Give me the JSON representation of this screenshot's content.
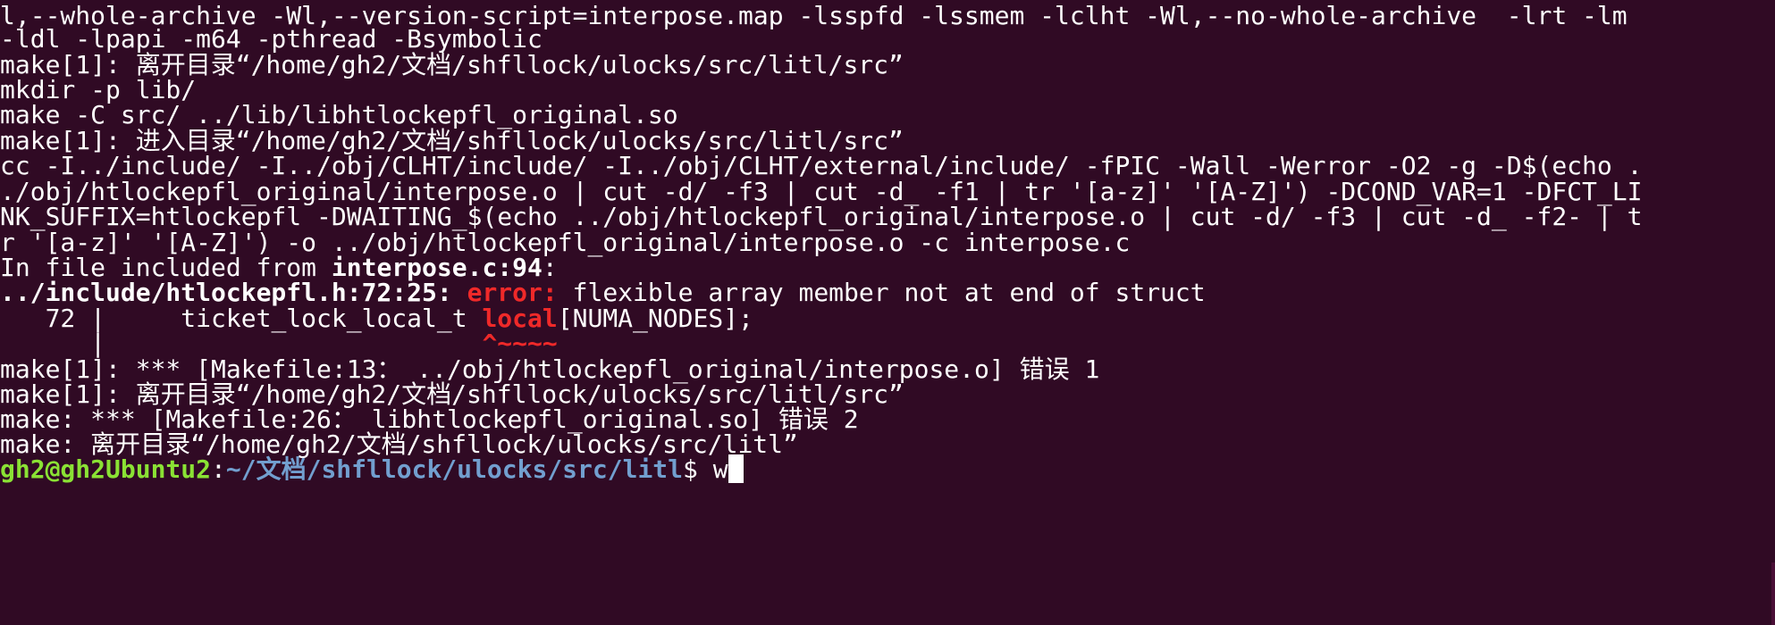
{
  "terminal": {
    "lines": [
      "l,--whole-archive -Wl,--version-script=interpose.map -lsspfd -lssmem -lclht -Wl,--no-whole-archive  -lrt -lm",
      "-ldl -lpapi -m64 -pthread -Bsymbolic",
      "make[1]: 离开目录“/home/gh2/文档/shfllock/ulocks/src/litl/src”",
      "mkdir -p lib/",
      "make -C src/ ../lib/libhtlockepfl_original.so",
      "make[1]: 进入目录“/home/gh2/文档/shfllock/ulocks/src/litl/src”",
      "cc -I../include/ -I../obj/CLHT/include/ -I../obj/CLHT/external/include/ -fPIC -Wall -Werror -O2 -g -D$(echo .",
      "./obj/htlockepfl_original/interpose.o | cut -d/ -f3 | cut -d_ -f1 | tr '[a-z]' '[A-Z]') -DCOND_VAR=1 -DFCT_LI",
      "NK_SUFFIX=htlockepfl -DWAITING_$(echo ../obj/htlockepfl_original/interpose.o | cut -d/ -f3 | cut -d_ -f2- | t",
      "r '[a-z]' '[A-Z]') -o ../obj/htlockepfl_original/interpose.o -c interpose.c"
    ],
    "include_line": {
      "prefix": "In file included from ",
      "file": "interpose.c:94",
      "suffix": ":"
    },
    "error_line": {
      "location": "../include/htlockepfl.h:72:25:",
      "label": "error:",
      "message": " flexible array member not at end of struct"
    },
    "code_line": {
      "gutter": "   72 |     ",
      "before": "ticket_lock_local_t ",
      "highlight": "local",
      "after": "[NUMA_NODES];"
    },
    "caret_line": {
      "gutter": "      |     ",
      "padding": "                    ",
      "caret": "^~~~~"
    },
    "tail_lines": [
      "make[1]: *** [Makefile:13： ../obj/htlockepfl_original/interpose.o] 错误 1",
      "make[1]: 离开目录“/home/gh2/文档/shfllock/ulocks/src/litl/src”",
      "make: *** [Makefile:26： libhtlockepfl_original.so] 错误 2",
      "make: 离开目录“/home/gh2/文档/shfllock/ulocks/src/litl”"
    ],
    "prompt": {
      "user_host": "gh2@gh2Ubuntu2",
      "separator": ":",
      "path": "~/文档/shfllock/ulocks/src/litl",
      "symbol": "$ ",
      "input": "w"
    },
    "colors": {
      "background": "#300a24",
      "text": "#ffffff",
      "error": "#ef2929",
      "prompt_user": "#8ae234",
      "prompt_path": "#729fcf"
    }
  }
}
